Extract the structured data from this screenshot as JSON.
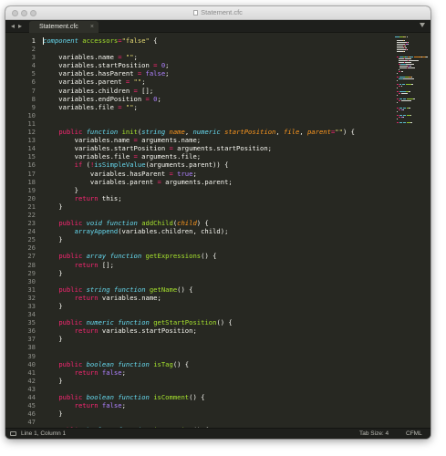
{
  "window": {
    "title": "Statement.cfc"
  },
  "tabbar": {
    "nav_back": "◂",
    "nav_forward": "▸",
    "active_tab": "Statement.cfc",
    "close": "×"
  },
  "code_lines": [
    [
      [
        "component ",
        "st"
      ],
      [
        "accessors",
        "fn"
      ],
      [
        "=",
        "k"
      ],
      [
        "\"false\"",
        "s"
      ],
      [
        " {",
        "v"
      ]
    ],
    [],
    [
      [
        "    variables.name ",
        "v"
      ],
      [
        "=",
        "k"
      ],
      [
        " ",
        "v"
      ],
      [
        "\"\"",
        "s"
      ],
      [
        ";",
        "v"
      ]
    ],
    [
      [
        "    variables.startPosition ",
        "v"
      ],
      [
        "=",
        "k"
      ],
      [
        " ",
        "v"
      ],
      [
        "0",
        "n"
      ],
      [
        ";",
        "v"
      ]
    ],
    [
      [
        "    variables.hasParent ",
        "v"
      ],
      [
        "=",
        "k"
      ],
      [
        " ",
        "v"
      ],
      [
        "false",
        "n"
      ],
      [
        ";",
        "v"
      ]
    ],
    [
      [
        "    variables.parent ",
        "v"
      ],
      [
        "=",
        "k"
      ],
      [
        " ",
        "v"
      ],
      [
        "\"\"",
        "s"
      ],
      [
        ";",
        "v"
      ]
    ],
    [
      [
        "    variables.children ",
        "v"
      ],
      [
        "=",
        "k"
      ],
      [
        " [];",
        "v"
      ]
    ],
    [
      [
        "    variables.endPosition ",
        "v"
      ],
      [
        "=",
        "k"
      ],
      [
        " ",
        "v"
      ],
      [
        "0",
        "n"
      ],
      [
        ";",
        "v"
      ]
    ],
    [
      [
        "    variables.file ",
        "v"
      ],
      [
        "=",
        "k"
      ],
      [
        " ",
        "v"
      ],
      [
        "\"\"",
        "s"
      ],
      [
        ";",
        "v"
      ]
    ],
    [],
    [],
    [
      [
        "    ",
        "v"
      ],
      [
        "public",
        "k"
      ],
      [
        " ",
        "v"
      ],
      [
        "function",
        "st"
      ],
      [
        " ",
        "v"
      ],
      [
        "init",
        "fn"
      ],
      [
        "(",
        "v"
      ],
      [
        "string",
        "st"
      ],
      [
        " ",
        "v"
      ],
      [
        "name",
        "p"
      ],
      [
        ", ",
        "v"
      ],
      [
        "numeric",
        "st"
      ],
      [
        " ",
        "v"
      ],
      [
        "startPosition",
        "p"
      ],
      [
        ", ",
        "v"
      ],
      [
        "file",
        "p"
      ],
      [
        ", ",
        "v"
      ],
      [
        "parent",
        "p"
      ],
      [
        "=",
        "k"
      ],
      [
        "\"\"",
        "s"
      ],
      [
        ") {",
        "v"
      ]
    ],
    [
      [
        "        variables.name ",
        "v"
      ],
      [
        "=",
        "k"
      ],
      [
        " arguments.name;",
        "v"
      ]
    ],
    [
      [
        "        variables.startPosition ",
        "v"
      ],
      [
        "=",
        "k"
      ],
      [
        " arguments.startPosition;",
        "v"
      ]
    ],
    [
      [
        "        variables.file ",
        "v"
      ],
      [
        "=",
        "k"
      ],
      [
        " arguments.file;",
        "v"
      ]
    ],
    [
      [
        "        ",
        "v"
      ],
      [
        "if",
        "k"
      ],
      [
        " (",
        "v"
      ],
      [
        "!",
        "k"
      ],
      [
        "isSimpleValue",
        "bi"
      ],
      [
        "(arguments.parent)) {",
        "v"
      ]
    ],
    [
      [
        "            variables.hasParent ",
        "v"
      ],
      [
        "=",
        "k"
      ],
      [
        " ",
        "v"
      ],
      [
        "true",
        "n"
      ],
      [
        ";",
        "v"
      ]
    ],
    [
      [
        "            variables.parent ",
        "v"
      ],
      [
        "=",
        "k"
      ],
      [
        " arguments.parent;",
        "v"
      ]
    ],
    [
      [
        "        }",
        "v"
      ]
    ],
    [
      [
        "        ",
        "v"
      ],
      [
        "return",
        "k"
      ],
      [
        " this;",
        "v"
      ]
    ],
    [
      [
        "    }",
        "v"
      ]
    ],
    [],
    [
      [
        "    ",
        "v"
      ],
      [
        "public",
        "k"
      ],
      [
        " ",
        "v"
      ],
      [
        "void",
        "st"
      ],
      [
        " ",
        "v"
      ],
      [
        "function",
        "st"
      ],
      [
        " ",
        "v"
      ],
      [
        "addChild",
        "fn"
      ],
      [
        "(",
        "v"
      ],
      [
        "child",
        "p"
      ],
      [
        ") {",
        "v"
      ]
    ],
    [
      [
        "        ",
        "v"
      ],
      [
        "arrayAppend",
        "bi"
      ],
      [
        "(variables.children, child);",
        "v"
      ]
    ],
    [
      [
        "    }",
        "v"
      ]
    ],
    [],
    [
      [
        "    ",
        "v"
      ],
      [
        "public",
        "k"
      ],
      [
        " ",
        "v"
      ],
      [
        "array",
        "st"
      ],
      [
        " ",
        "v"
      ],
      [
        "function",
        "st"
      ],
      [
        " ",
        "v"
      ],
      [
        "getExpressions",
        "fn"
      ],
      [
        "() {",
        "v"
      ]
    ],
    [
      [
        "        ",
        "v"
      ],
      [
        "return",
        "k"
      ],
      [
        " [];",
        "v"
      ]
    ],
    [
      [
        "    }",
        "v"
      ]
    ],
    [],
    [
      [
        "    ",
        "v"
      ],
      [
        "public",
        "k"
      ],
      [
        " ",
        "v"
      ],
      [
        "string",
        "st"
      ],
      [
        " ",
        "v"
      ],
      [
        "function",
        "st"
      ],
      [
        " ",
        "v"
      ],
      [
        "getName",
        "fn"
      ],
      [
        "() {",
        "v"
      ]
    ],
    [
      [
        "        ",
        "v"
      ],
      [
        "return",
        "k"
      ],
      [
        " variables.name;",
        "v"
      ]
    ],
    [
      [
        "    }",
        "v"
      ]
    ],
    [],
    [
      [
        "    ",
        "v"
      ],
      [
        "public",
        "k"
      ],
      [
        " ",
        "v"
      ],
      [
        "numeric",
        "st"
      ],
      [
        " ",
        "v"
      ],
      [
        "function",
        "st"
      ],
      [
        " ",
        "v"
      ],
      [
        "getStartPosition",
        "fn"
      ],
      [
        "() {",
        "v"
      ]
    ],
    [
      [
        "        ",
        "v"
      ],
      [
        "return",
        "k"
      ],
      [
        " variables.startPosition;",
        "v"
      ]
    ],
    [
      [
        "    }",
        "v"
      ]
    ],
    [],
    [],
    [
      [
        "    ",
        "v"
      ],
      [
        "public",
        "k"
      ],
      [
        " ",
        "v"
      ],
      [
        "boolean",
        "st"
      ],
      [
        " ",
        "v"
      ],
      [
        "function",
        "st"
      ],
      [
        " ",
        "v"
      ],
      [
        "isTag",
        "fn"
      ],
      [
        "() {",
        "v"
      ]
    ],
    [
      [
        "        ",
        "v"
      ],
      [
        "return",
        "k"
      ],
      [
        " ",
        "v"
      ],
      [
        "false",
        "n"
      ],
      [
        ";",
        "v"
      ]
    ],
    [
      [
        "    }",
        "v"
      ]
    ],
    [],
    [
      [
        "    ",
        "v"
      ],
      [
        "public",
        "k"
      ],
      [
        " ",
        "v"
      ],
      [
        "boolean",
        "st"
      ],
      [
        " ",
        "v"
      ],
      [
        "function",
        "st"
      ],
      [
        " ",
        "v"
      ],
      [
        "isComment",
        "fn"
      ],
      [
        "() {",
        "v"
      ]
    ],
    [
      [
        "        ",
        "v"
      ],
      [
        "return",
        "k"
      ],
      [
        " ",
        "v"
      ],
      [
        "false",
        "n"
      ],
      [
        ";",
        "v"
      ]
    ],
    [
      [
        "    }",
        "v"
      ]
    ],
    [],
    [
      [
        "    ",
        "v"
      ],
      [
        "public",
        "k"
      ],
      [
        " ",
        "v"
      ],
      [
        "boolean",
        "st"
      ],
      [
        " ",
        "v"
      ],
      [
        "function",
        "st"
      ],
      [
        " ",
        "v"
      ],
      [
        "isFunction",
        "fn"
      ],
      [
        "() {",
        "v"
      ]
    ]
  ],
  "statusbar": {
    "position": "Line 1, Column 1",
    "tab_size": "Tab Size: 4",
    "syntax": "CFML"
  },
  "colors": {
    "background": "#272822",
    "keyword": "#f92672",
    "storage_type": "#66d9ef",
    "function_name": "#a6e22e",
    "parameter": "#fd971f",
    "string": "#e6db74",
    "number": "#ae81ff",
    "text": "#f8f8f2"
  }
}
